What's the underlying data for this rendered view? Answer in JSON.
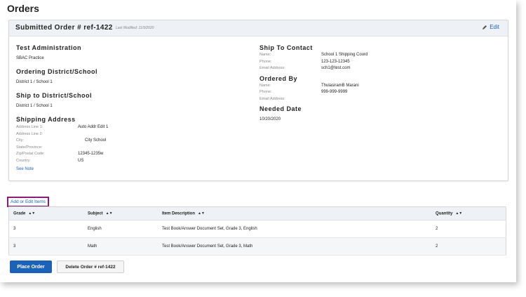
{
  "page": {
    "title": "Orders"
  },
  "card": {
    "title": "Submitted Order # ref-1422",
    "last_modified": "Last Modified: 11/9/2020",
    "edit_label": "Edit"
  },
  "left": {
    "test_admin": {
      "heading": "Test Administration",
      "value": "SBAC Practice"
    },
    "ordering": {
      "heading": "Ordering District/School",
      "value": "District 1 / School 1"
    },
    "ship_to": {
      "heading": "Ship to District/School",
      "value": "District 1 / School 1"
    },
    "shipping": {
      "heading": "Shipping Address",
      "fields": [
        {
          "label": "Address Line 1:",
          "value": "Auto Addr Edit 1"
        },
        {
          "label": "Address Line 2:",
          "value": ""
        },
        {
          "label": "City:",
          "value": "City School"
        },
        {
          "label": "State/Province:",
          "value": ""
        },
        {
          "label": "Zip/Postal Code:",
          "value": "12345-1235w"
        },
        {
          "label": "Country:",
          "value": "US"
        }
      ],
      "see_note": "See Note"
    }
  },
  "right": {
    "contact": {
      "heading": "Ship To Contact",
      "fields": [
        {
          "label": "Name:",
          "value": "School 1 Shipping Coord"
        },
        {
          "label": "Phone:",
          "value": "123-123-12345"
        },
        {
          "label": "Email Address:",
          "value": "sch1@test.com"
        }
      ]
    },
    "ordered_by": {
      "heading": "Ordered By",
      "fields": [
        {
          "label": "Name:",
          "value": "ThulasiramB Marani"
        },
        {
          "label": "Phone:",
          "value": "999-999-9999"
        },
        {
          "label": "Email Address:",
          "value": ""
        }
      ]
    },
    "needed": {
      "heading": "Needed Date",
      "value": "10/20/2020"
    }
  },
  "items": {
    "add_edit_label": "Add or Edit Items",
    "columns": [
      "Grade",
      "Subject",
      "Item Description",
      "Quantity"
    ],
    "rows": [
      [
        "3",
        "English",
        "Test Book/Answer Document Set, Grade 3, English",
        "2"
      ],
      [
        "3",
        "Math",
        "Test Book/Answer Document Set, Grade 3, Math",
        "2"
      ]
    ]
  },
  "actions": {
    "place_order": "Place Order",
    "delete_order": "Delete Order # ref-1422"
  },
  "colors": {
    "accent": "#1c63b7",
    "highlight_border": "#8b1a7a"
  }
}
